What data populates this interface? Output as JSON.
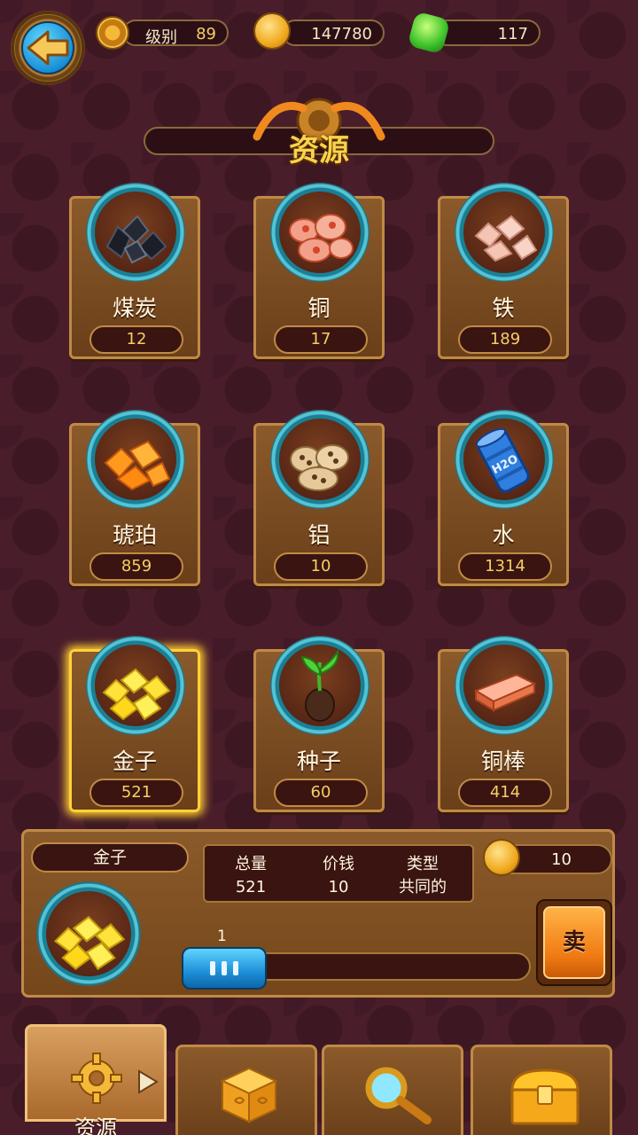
{
  "header": {
    "level_label": "级别",
    "level_value": "89",
    "coins": "147780",
    "gems": "117"
  },
  "title": "资源",
  "resources": [
    {
      "name": "煤炭",
      "count": "12",
      "icon": "coal-icon"
    },
    {
      "name": "铜",
      "count": "17",
      "icon": "copper-ore-icon"
    },
    {
      "name": "铁",
      "count": "189",
      "icon": "iron-ore-icon"
    },
    {
      "name": "琥珀",
      "count": "859",
      "icon": "amber-icon"
    },
    {
      "name": "铝",
      "count": "10",
      "icon": "aluminum-ore-icon"
    },
    {
      "name": "水",
      "count": "1314",
      "icon": "water-barrel-icon",
      "barrel_text": "H2O"
    },
    {
      "name": "金子",
      "count": "521",
      "icon": "gold-nuggets-icon",
      "selected": true
    },
    {
      "name": "种子",
      "count": "60",
      "icon": "seed-sprout-icon"
    },
    {
      "name": "铜棒",
      "count": "414",
      "icon": "copper-bar-icon"
    }
  ],
  "detail": {
    "name": "金子",
    "total_label": "总量",
    "total_value": "521",
    "price_label": "价钱",
    "price_value": "10",
    "type_label": "类型",
    "type_value": "共同的",
    "sale_price": "10",
    "quantity": "1",
    "sell_label": "卖"
  },
  "tabs": [
    {
      "label": "资源",
      "icon": "gear-icon",
      "active": true
    },
    {
      "label": "",
      "icon": "dice-icon"
    },
    {
      "label": "",
      "icon": "magnifier-icon"
    },
    {
      "label": "",
      "icon": "treasure-chest-icon"
    }
  ],
  "colors": {
    "background": "#4a1d2b",
    "card": "#8b5a2b",
    "card_border": "#c08a45",
    "title_text": "#f7d44a",
    "count_text": "#f5cf63",
    "selected_glow": "#ffcc33",
    "accent_blue": "#1d8fd8",
    "sell_button": "#f07a12"
  }
}
